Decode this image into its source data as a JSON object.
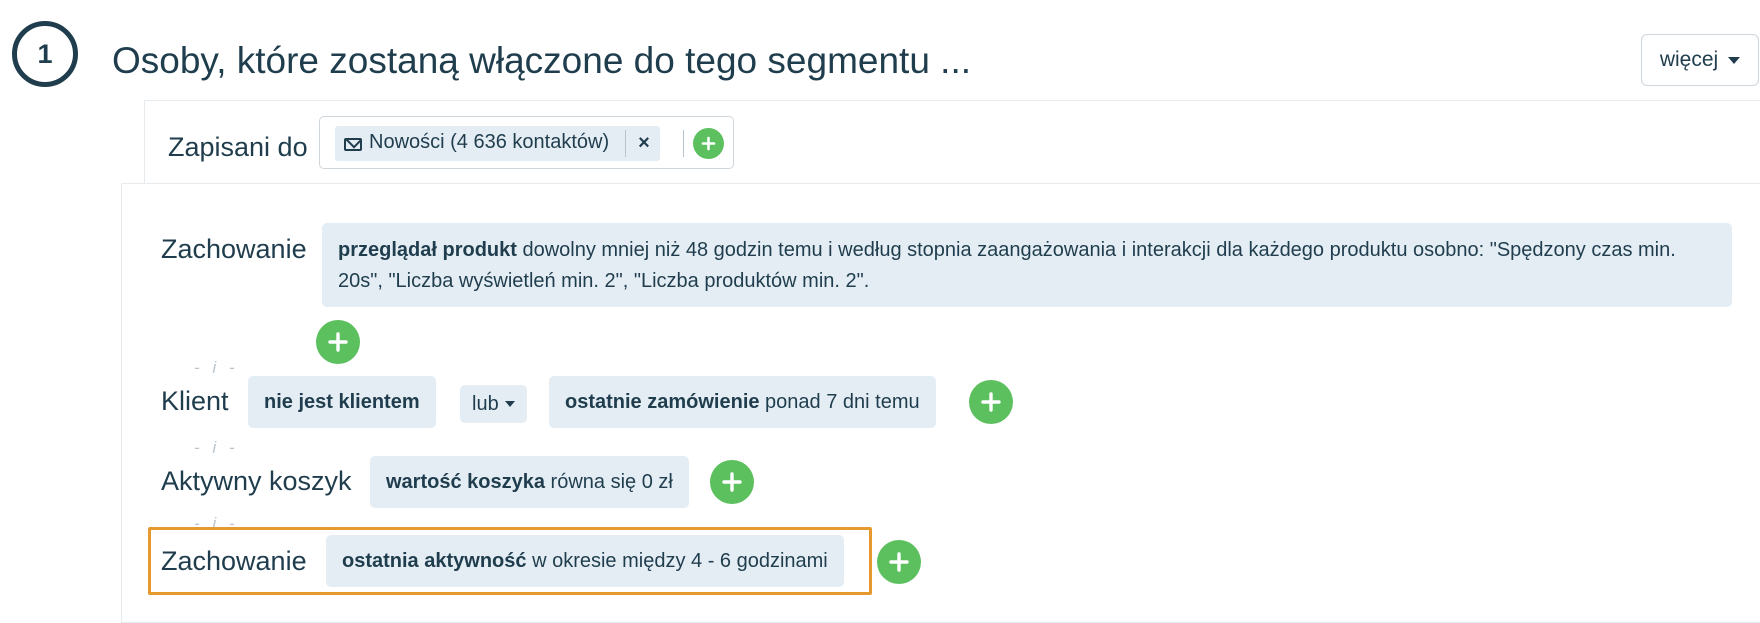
{
  "header": {
    "step_number": "1",
    "title": "Osoby, które zostaną włączone do tego segmentu ...",
    "more_label": "więcej"
  },
  "subscribed": {
    "label": "Zapisani do",
    "list_tag": "Nowości (4 636 kontaktów)",
    "remove_symbol": "×"
  },
  "connector_text": "- i -",
  "conditions": {
    "behavior1": {
      "label": "Zachowanie",
      "chip_bold": "przeglądał produkt",
      "chip_text": " dowolny mniej niż 48 godzin temu i według stopnia zaangażowania i interakcji dla każdego produktu osobno: \"Spędzony czas min. 20s\", \"Liczba wyświetleń min. 2\", \"Liczba produktów min. 2\"."
    },
    "client": {
      "label": "Klient",
      "chip1_bold": "nie jest klientem",
      "operator": "lub",
      "chip2_bold": "ostatnie zamówienie",
      "chip2_text": " ponad 7 dni temu"
    },
    "cart": {
      "label": "Aktywny koszyk",
      "chip_bold": "wartość koszyka",
      "chip_text": " równa się 0 zł"
    },
    "behavior2": {
      "label": "Zachowanie",
      "chip_bold": "ostatnia aktywność",
      "chip_text": " w okresie między 4 - 6 godzinami"
    }
  },
  "colors": {
    "primary_text": "#1f3d4d",
    "chip_bg": "#e4edf4",
    "add_button": "#5cc05f",
    "highlight": "#e69a2e"
  }
}
